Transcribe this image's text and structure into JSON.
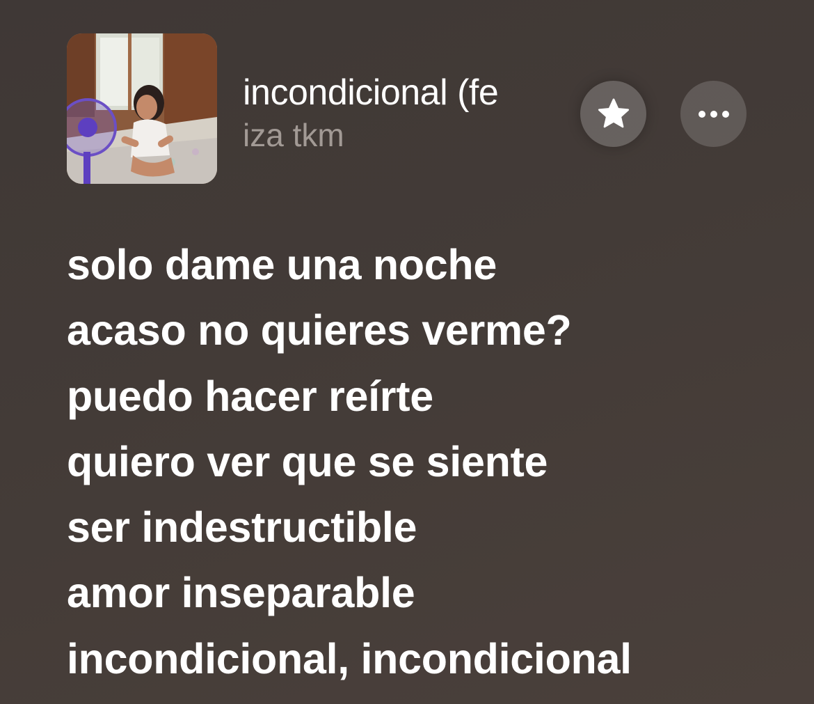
{
  "now_playing": {
    "title": "incondicional (fe",
    "artist": "iza tkm"
  },
  "controls": {
    "favorite_icon": "star-icon",
    "more_icon": "ellipsis-icon"
  },
  "lyrics": [
    "solo dame una noche",
    "acaso no quieres verme?",
    "puedo hacer reírte",
    "quiero ver que se siente",
    "ser indestructible",
    "amor inseparable",
    "incondicional, incondicional"
  ],
  "colors": {
    "background": "#433b37",
    "text_primary": "#ffffff",
    "text_secondary": "#a29a95"
  }
}
